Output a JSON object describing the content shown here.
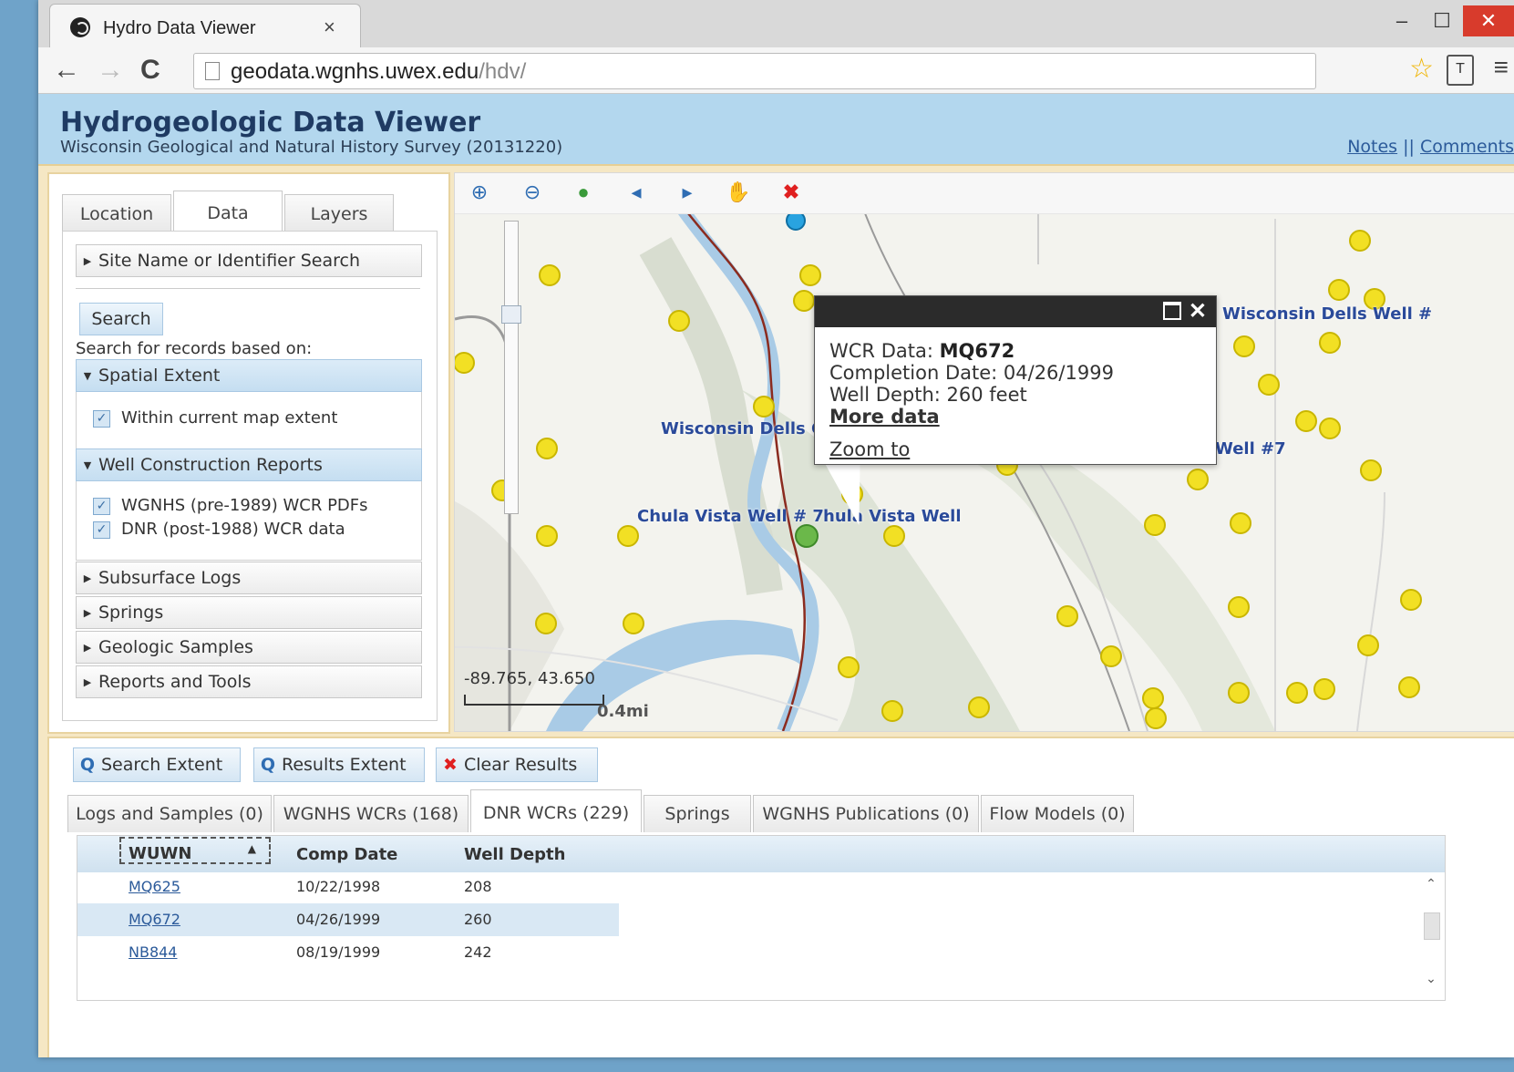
{
  "browser": {
    "tab_title": "Hydro Data Viewer",
    "tab_close": "×",
    "url_host": "geodata.wgnhs.uwex.edu",
    "url_path": "/hdv/",
    "win_min": "‒",
    "win_max": "☐",
    "win_close": "✕"
  },
  "app": {
    "title": "Hydrogeologic Data Viewer",
    "subtitle": "Wisconsin Geological and Natural History Survey (20131220)",
    "link_notes": "Notes",
    "link_sep": "||",
    "link_comments": "Comments"
  },
  "left_panel": {
    "tabs": [
      "Location",
      "Data",
      "Layers"
    ],
    "site_search": "Site Name or Identifier Search",
    "search_button": "Search",
    "search_for": "Search for records based on:",
    "spatial_extent": "Spatial Extent",
    "within_extent": "Within current map extent",
    "wcr_section": "Well Construction Reports",
    "wgnhs_pdfs": "WGNHS (pre-1989) WCR PDFs",
    "dnr_data": "DNR (post-1988) WCR data",
    "subsurface_logs": "Subsurface Logs",
    "springs": "Springs",
    "geologic_samples": "Geologic Samples",
    "reports_tools": "Reports and Tools"
  },
  "map": {
    "popup": {
      "wcr_label": "WCR Data:",
      "wcr_value": "MQ672",
      "completion": "Completion Date: 04/26/1999",
      "depth": "Well Depth: 260 feet",
      "more_data": "More data",
      "zoom_to": "Zoom to"
    },
    "labels": {
      "wis_dells_well_top": "Wisconsin Dells Well #",
      "wis_dells_left": "Wisconsin Dells C",
      "well7_right": "Well #7",
      "chula1": "Chula Vista Well # 7",
      "chula2": "hula Vista Well"
    },
    "coord": "-89.765, 43.650",
    "scale": "0.4mi"
  },
  "bottom": {
    "search_extent": "Search Extent",
    "results_extent": "Results Extent",
    "clear_results": "Clear Results",
    "tabs": [
      "Logs and Samples (0)",
      "WGNHS WCRs (168)",
      "DNR WCRs (229)",
      "Springs",
      "WGNHS Publications (0)",
      "Flow Models (0)"
    ],
    "columns": [
      "WUWN",
      "Comp Date",
      "Well Depth"
    ],
    "rows": [
      {
        "id": "MQ625",
        "date": "10/22/1998",
        "depth": "208"
      },
      {
        "id": "MQ672",
        "date": "04/26/1999",
        "depth": "260"
      },
      {
        "id": "NB844",
        "date": "08/19/1999",
        "depth": "242"
      }
    ]
  },
  "colors": {
    "header_bg": "#b3d7ee",
    "frame": "#f5e7c4",
    "well_dot": "#f2e024",
    "link": "#2b5a9a"
  }
}
